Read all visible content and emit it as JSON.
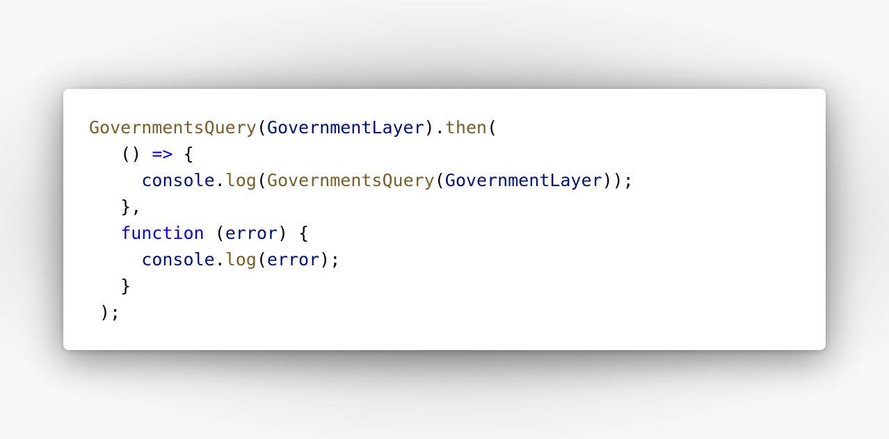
{
  "code": {
    "lines": [
      [
        {
          "text": "GovernmentsQuery",
          "role": "function"
        },
        {
          "text": "(",
          "role": "punct"
        },
        {
          "text": "GovernmentLayer",
          "role": "identifier"
        },
        {
          "text": ").",
          "role": "punct"
        },
        {
          "text": "then",
          "role": "function"
        },
        {
          "text": "(",
          "role": "punct"
        }
      ],
      [
        {
          "text": "   () ",
          "role": "punct"
        },
        {
          "text": "=>",
          "role": "keyword"
        },
        {
          "text": " {",
          "role": "punct"
        }
      ],
      [
        {
          "text": "     ",
          "role": "punct"
        },
        {
          "text": "console",
          "role": "identifier"
        },
        {
          "text": ".",
          "role": "punct"
        },
        {
          "text": "log",
          "role": "function"
        },
        {
          "text": "(",
          "role": "punct"
        },
        {
          "text": "GovernmentsQuery",
          "role": "function"
        },
        {
          "text": "(",
          "role": "punct"
        },
        {
          "text": "GovernmentLayer",
          "role": "identifier"
        },
        {
          "text": "));",
          "role": "punct"
        }
      ],
      [
        {
          "text": "   },",
          "role": "punct"
        }
      ],
      [
        {
          "text": "   ",
          "role": "punct"
        },
        {
          "text": "function",
          "role": "keyword"
        },
        {
          "text": " (",
          "role": "punct"
        },
        {
          "text": "error",
          "role": "identifier"
        },
        {
          "text": ") {",
          "role": "punct"
        }
      ],
      [
        {
          "text": "     ",
          "role": "punct"
        },
        {
          "text": "console",
          "role": "identifier"
        },
        {
          "text": ".",
          "role": "punct"
        },
        {
          "text": "log",
          "role": "function"
        },
        {
          "text": "(",
          "role": "punct"
        },
        {
          "text": "error",
          "role": "identifier"
        },
        {
          "text": ");",
          "role": "punct"
        }
      ],
      [
        {
          "text": "   }",
          "role": "punct"
        }
      ],
      [
        {
          "text": " );",
          "role": "punct"
        }
      ]
    ]
  },
  "colors": {
    "function": "#795e26",
    "identifier": "#001080",
    "keyword": "#0000ff",
    "punct": "#000000",
    "card_background": "#ffffff"
  }
}
